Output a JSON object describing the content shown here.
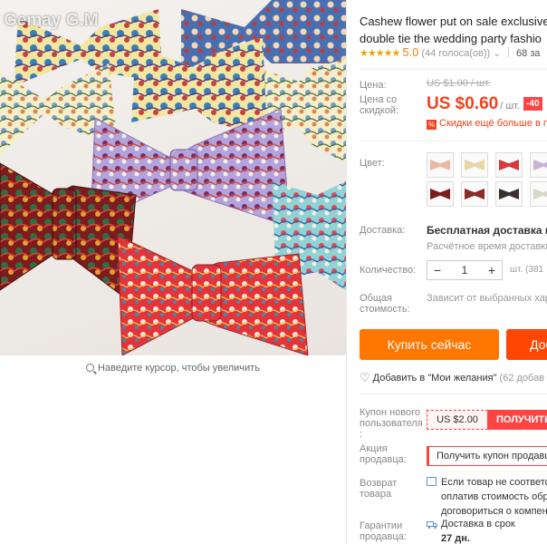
{
  "gallery": {
    "watermark": "Gemay G.M",
    "zoom_hint": "Наведите курсор, чтобы увеличить"
  },
  "product": {
    "title_line1": "Cashew flower put on sale exclusive",
    "title_line2": "double tie the wedding party fashio",
    "stars": "★★★★★",
    "rating": "5.0",
    "reviews": "(44 голоса(ов))",
    "orders": "68 за"
  },
  "price": {
    "label_price": "Цена:",
    "label_sale": "Цена со скидкой:",
    "old": "US $1.00 / шт.",
    "current": "US $0.60",
    "per": "/ шт.",
    "discount": "-40",
    "bulk_text": "Скидки ещё больше в пр"
  },
  "color": {
    "label": "Цвет:",
    "swatch_colors": [
      "#e8b9a3",
      "#e7d6a6",
      "#d63a3a",
      "#c9b4d6",
      "#7a1c1c",
      "#8c2a2a",
      "#3a3030",
      "#d8d6c8"
    ]
  },
  "shipping": {
    "label": "Доставка:",
    "value": "Бесплатная доставка в Ru",
    "eta": "Расчётное время доставки:"
  },
  "quantity": {
    "label": "Количество:",
    "minus": "−",
    "value": "1",
    "plus": "+",
    "note": "шт. (381"
  },
  "total": {
    "label": "Общая стоимость:",
    "value": "Зависит от выбранных хара"
  },
  "actions": {
    "buy_now": "Купить сейчас",
    "add_to_cart": "Доб",
    "wishlist": "Добавить в \"Мои желания\"",
    "wishlist_count": "(62 добав"
  },
  "coupon": {
    "label": "Купон нового пользователя :",
    "amount": "US $2.00",
    "button": "ПОЛУЧИТЬ"
  },
  "promo": {
    "label": "Акция продавца:",
    "text": "Получить купон продавц"
  },
  "returns": {
    "label": "Возврат товара",
    "line1": "Если товар не соответст",
    "line2": "оплатив стоимость обра",
    "line3": "договориться о компен"
  },
  "guarantee": {
    "label": "Гарантии продавца:",
    "line1": "Доставка в срок",
    "line2": "27 дн."
  },
  "colors": {
    "accent_orange": "#ff7600",
    "accent_red": "#f4411b",
    "star": "#f0a30a"
  }
}
